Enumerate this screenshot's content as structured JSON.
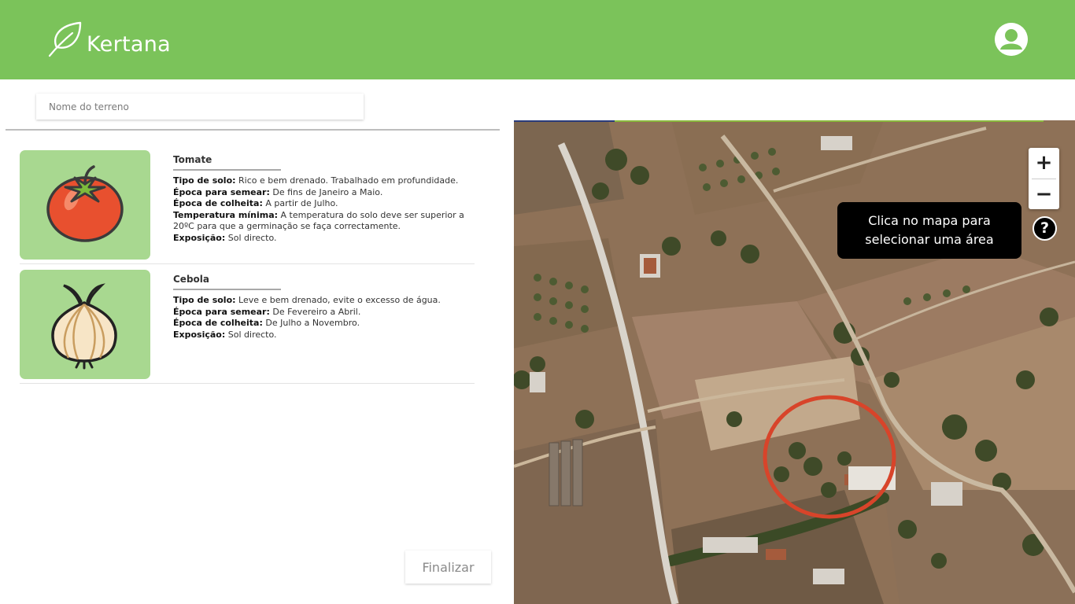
{
  "app": {
    "name": "Kertana"
  },
  "header": {
    "logo_icon": "leaf-icon",
    "user_icon": "user-icon"
  },
  "land": {
    "name_placeholder": "Nome do terreno",
    "name_value": ""
  },
  "crops": [
    {
      "title": "Tomate",
      "image_icon": "tomato-icon",
      "lines": [
        {
          "label": "Tipo de solo:",
          "value": " Rico e bem drenado. Trabalhado em profundidade."
        },
        {
          "label": "Época para semear:",
          "value": " De fins de Janeiro a Maio."
        },
        {
          "label": "Época de colheita:",
          "value": " A partir de Julho."
        },
        {
          "label": "Temperatura mínima:",
          "value": " A temperatura do solo deve ser superior a 20ºC para que a germinação se faça correctamente."
        },
        {
          "label": "Exposição:",
          "value": " Sol directo."
        }
      ]
    },
    {
      "title": "Cebola",
      "image_icon": "onion-icon",
      "lines": [
        {
          "label": "Tipo de solo:",
          "value": " Leve e bem drenado, evite o excesso de água."
        },
        {
          "label": "Época para semear:",
          "value": " De Fevereiro a Abril."
        },
        {
          "label": "Época de colheita:",
          "value": " De Julho a Novembro."
        },
        {
          "label": "Exposição:",
          "value": " Sol directo."
        }
      ]
    }
  ],
  "actions": {
    "finish_label": "Finalizar"
  },
  "map": {
    "zoom_in_label": "+",
    "zoom_out_label": "−",
    "tooltip_text": "Clica no mapa para selecionar uma área",
    "help_label": "?"
  },
  "colors": {
    "header": "#7bc35a",
    "crop_bg": "#a8d890",
    "selection_ring": "#d8442a"
  }
}
